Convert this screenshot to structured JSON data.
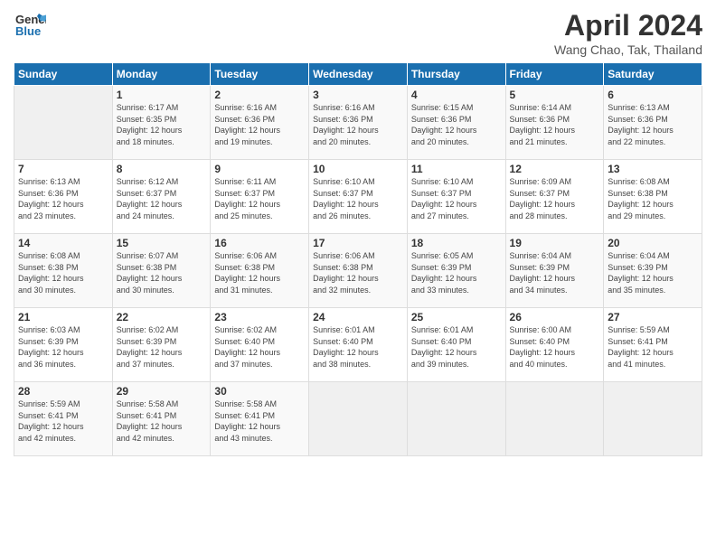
{
  "header": {
    "logo_line1": "General",
    "logo_line2": "Blue",
    "title": "April 2024",
    "subtitle": "Wang Chao, Tak, Thailand"
  },
  "days_of_week": [
    "Sunday",
    "Monday",
    "Tuesday",
    "Wednesday",
    "Thursday",
    "Friday",
    "Saturday"
  ],
  "weeks": [
    [
      {
        "day": "",
        "empty": true
      },
      {
        "day": "1",
        "sunrise": "6:17 AM",
        "sunset": "6:35 PM",
        "daylight": "12 hours and 18 minutes."
      },
      {
        "day": "2",
        "sunrise": "6:16 AM",
        "sunset": "6:36 PM",
        "daylight": "12 hours and 19 minutes."
      },
      {
        "day": "3",
        "sunrise": "6:16 AM",
        "sunset": "6:36 PM",
        "daylight": "12 hours and 20 minutes."
      },
      {
        "day": "4",
        "sunrise": "6:15 AM",
        "sunset": "6:36 PM",
        "daylight": "12 hours and 20 minutes."
      },
      {
        "day": "5",
        "sunrise": "6:14 AM",
        "sunset": "6:36 PM",
        "daylight": "12 hours and 21 minutes."
      },
      {
        "day": "6",
        "sunrise": "6:13 AM",
        "sunset": "6:36 PM",
        "daylight": "12 hours and 22 minutes."
      }
    ],
    [
      {
        "day": "7",
        "sunrise": "6:13 AM",
        "sunset": "6:36 PM",
        "daylight": "12 hours and 23 minutes."
      },
      {
        "day": "8",
        "sunrise": "6:12 AM",
        "sunset": "6:37 PM",
        "daylight": "12 hours and 24 minutes."
      },
      {
        "day": "9",
        "sunrise": "6:11 AM",
        "sunset": "6:37 PM",
        "daylight": "12 hours and 25 minutes."
      },
      {
        "day": "10",
        "sunrise": "6:10 AM",
        "sunset": "6:37 PM",
        "daylight": "12 hours and 26 minutes."
      },
      {
        "day": "11",
        "sunrise": "6:10 AM",
        "sunset": "6:37 PM",
        "daylight": "12 hours and 27 minutes."
      },
      {
        "day": "12",
        "sunrise": "6:09 AM",
        "sunset": "6:37 PM",
        "daylight": "12 hours and 28 minutes."
      },
      {
        "day": "13",
        "sunrise": "6:08 AM",
        "sunset": "6:38 PM",
        "daylight": "12 hours and 29 minutes."
      }
    ],
    [
      {
        "day": "14",
        "sunrise": "6:08 AM",
        "sunset": "6:38 PM",
        "daylight": "12 hours and 30 minutes."
      },
      {
        "day": "15",
        "sunrise": "6:07 AM",
        "sunset": "6:38 PM",
        "daylight": "12 hours and 30 minutes."
      },
      {
        "day": "16",
        "sunrise": "6:06 AM",
        "sunset": "6:38 PM",
        "daylight": "12 hours and 31 minutes."
      },
      {
        "day": "17",
        "sunrise": "6:06 AM",
        "sunset": "6:38 PM",
        "daylight": "12 hours and 32 minutes."
      },
      {
        "day": "18",
        "sunrise": "6:05 AM",
        "sunset": "6:39 PM",
        "daylight": "12 hours and 33 minutes."
      },
      {
        "day": "19",
        "sunrise": "6:04 AM",
        "sunset": "6:39 PM",
        "daylight": "12 hours and 34 minutes."
      },
      {
        "day": "20",
        "sunrise": "6:04 AM",
        "sunset": "6:39 PM",
        "daylight": "12 hours and 35 minutes."
      }
    ],
    [
      {
        "day": "21",
        "sunrise": "6:03 AM",
        "sunset": "6:39 PM",
        "daylight": "12 hours and 36 minutes."
      },
      {
        "day": "22",
        "sunrise": "6:02 AM",
        "sunset": "6:39 PM",
        "daylight": "12 hours and 37 minutes."
      },
      {
        "day": "23",
        "sunrise": "6:02 AM",
        "sunset": "6:40 PM",
        "daylight": "12 hours and 37 minutes."
      },
      {
        "day": "24",
        "sunrise": "6:01 AM",
        "sunset": "6:40 PM",
        "daylight": "12 hours and 38 minutes."
      },
      {
        "day": "25",
        "sunrise": "6:01 AM",
        "sunset": "6:40 PM",
        "daylight": "12 hours and 39 minutes."
      },
      {
        "day": "26",
        "sunrise": "6:00 AM",
        "sunset": "6:40 PM",
        "daylight": "12 hours and 40 minutes."
      },
      {
        "day": "27",
        "sunrise": "5:59 AM",
        "sunset": "6:41 PM",
        "daylight": "12 hours and 41 minutes."
      }
    ],
    [
      {
        "day": "28",
        "sunrise": "5:59 AM",
        "sunset": "6:41 PM",
        "daylight": "12 hours and 42 minutes."
      },
      {
        "day": "29",
        "sunrise": "5:58 AM",
        "sunset": "6:41 PM",
        "daylight": "12 hours and 42 minutes."
      },
      {
        "day": "30",
        "sunrise": "5:58 AM",
        "sunset": "6:41 PM",
        "daylight": "12 hours and 43 minutes."
      },
      {
        "day": "",
        "empty": true
      },
      {
        "day": "",
        "empty": true
      },
      {
        "day": "",
        "empty": true
      },
      {
        "day": "",
        "empty": true
      }
    ]
  ],
  "labels": {
    "sunrise_prefix": "Sunrise: ",
    "sunset_prefix": "Sunset: ",
    "daylight_prefix": "Daylight: "
  }
}
